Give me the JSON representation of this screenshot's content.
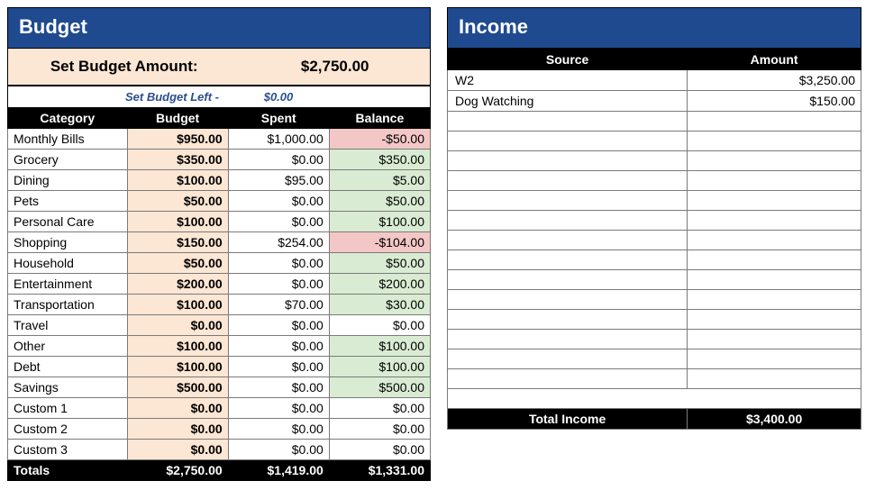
{
  "budget": {
    "title": "Budget",
    "set_label": "Set Budget Amount:",
    "set_amount": "$2,750.00",
    "left_label": "Set Budget Left -",
    "left_value": "$0.00",
    "headers": {
      "category": "Category",
      "budget": "Budget",
      "spent": "Spent",
      "balance": "Balance"
    },
    "rows": [
      {
        "category": "Monthly Bills",
        "budget": "$950.00",
        "spent": "$1,000.00",
        "balance": "-$50.00",
        "neg": true
      },
      {
        "category": "Grocery",
        "budget": "$350.00",
        "spent": "$0.00",
        "balance": "$350.00",
        "pos": true
      },
      {
        "category": "Dining",
        "budget": "$100.00",
        "spent": "$95.00",
        "balance": "$5.00",
        "pos": true
      },
      {
        "category": "Pets",
        "budget": "$50.00",
        "spent": "$0.00",
        "balance": "$50.00",
        "pos": true
      },
      {
        "category": "Personal Care",
        "budget": "$100.00",
        "spent": "$0.00",
        "balance": "$100.00",
        "pos": true
      },
      {
        "category": "Shopping",
        "budget": "$150.00",
        "spent": "$254.00",
        "balance": "-$104.00",
        "neg": true
      },
      {
        "category": "Household",
        "budget": "$50.00",
        "spent": "$0.00",
        "balance": "$50.00",
        "pos": true
      },
      {
        "category": "Entertainment",
        "budget": "$200.00",
        "spent": "$0.00",
        "balance": "$200.00",
        "pos": true
      },
      {
        "category": "Transportation",
        "budget": "$100.00",
        "spent": "$70.00",
        "balance": "$30.00",
        "pos": true
      },
      {
        "category": "Travel",
        "budget": "$0.00",
        "spent": "$0.00",
        "balance": "$0.00"
      },
      {
        "category": "Other",
        "budget": "$100.00",
        "spent": "$0.00",
        "balance": "$100.00",
        "pos": true
      },
      {
        "category": "Debt",
        "budget": "$100.00",
        "spent": "$0.00",
        "balance": "$100.00",
        "pos": true
      },
      {
        "category": "Savings",
        "budget": "$500.00",
        "spent": "$0.00",
        "balance": "$500.00",
        "pos": true
      },
      {
        "category": "Custom 1",
        "budget": "$0.00",
        "spent": "$0.00",
        "balance": "$0.00"
      },
      {
        "category": "Custom 2",
        "budget": "$0.00",
        "spent": "$0.00",
        "balance": "$0.00"
      },
      {
        "category": "Custom 3",
        "budget": "$0.00",
        "spent": "$0.00",
        "balance": "$0.00"
      }
    ],
    "totals": {
      "label": "Totals",
      "budget": "$2,750.00",
      "spent": "$1,419.00",
      "balance": "$1,331.00"
    }
  },
  "income": {
    "title": "Income",
    "headers": {
      "source": "Source",
      "amount": "Amount"
    },
    "rows": [
      {
        "source": "W2",
        "amount": "$3,250.00"
      },
      {
        "source": "Dog Watching",
        "amount": "$150.00"
      },
      {
        "source": "",
        "amount": ""
      },
      {
        "source": "",
        "amount": ""
      },
      {
        "source": "",
        "amount": ""
      },
      {
        "source": "",
        "amount": ""
      },
      {
        "source": "",
        "amount": ""
      },
      {
        "source": "",
        "amount": ""
      },
      {
        "source": "",
        "amount": ""
      },
      {
        "source": "",
        "amount": ""
      },
      {
        "source": "",
        "amount": ""
      },
      {
        "source": "",
        "amount": ""
      },
      {
        "source": "",
        "amount": ""
      },
      {
        "source": "",
        "amount": ""
      },
      {
        "source": "",
        "amount": ""
      },
      {
        "source": "",
        "amount": ""
      }
    ],
    "total_label": "Total Income",
    "total_value": "$3,400.00"
  }
}
